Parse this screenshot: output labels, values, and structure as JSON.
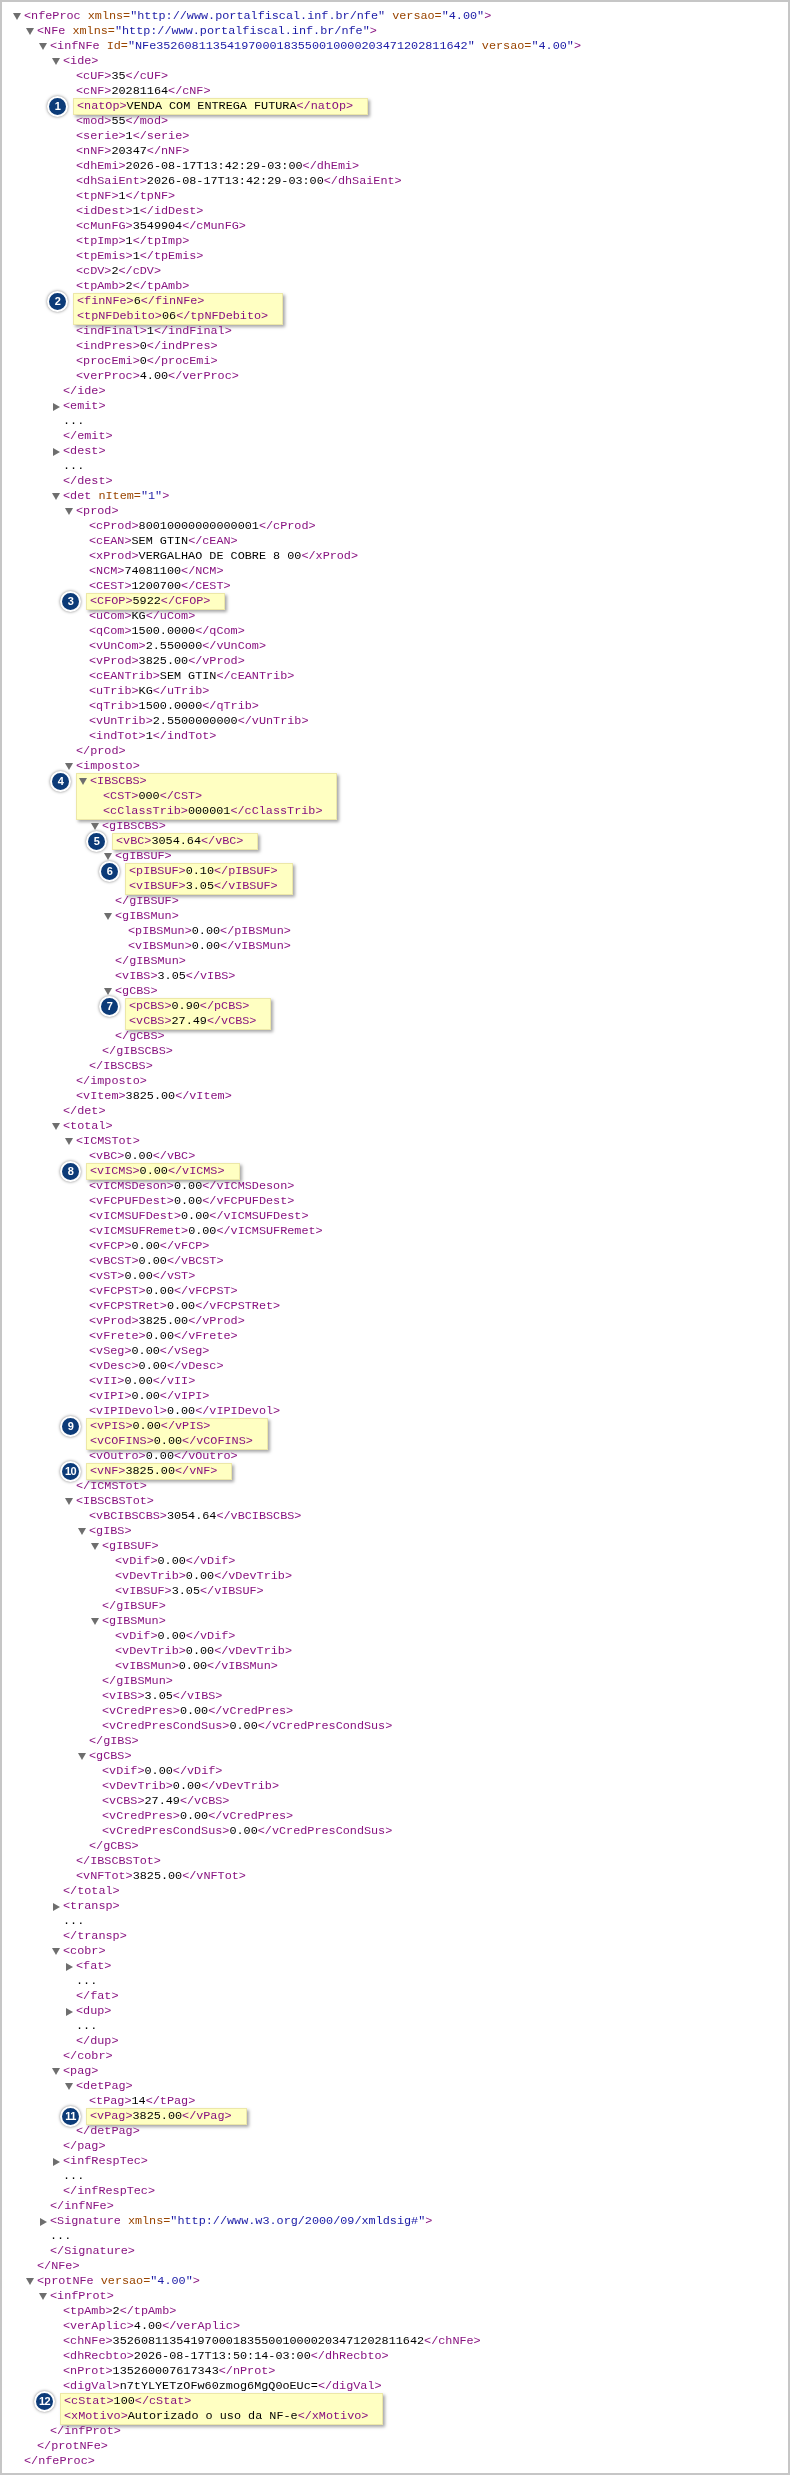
{
  "xml_tree": {
    "open_parts": [
      {
        "kind": "tag",
        "text": "<nfeProc"
      },
      {
        "kind": "attr",
        "text": " xmlns="
      },
      {
        "kind": "value",
        "text": "\"http://www.portalfiscal.inf.br/nfe\""
      },
      {
        "kind": "attr",
        "text": " versao="
      },
      {
        "kind": "value",
        "text": "\"4.00\""
      },
      {
        "kind": "tag",
        "text": ">"
      }
    ],
    "expanded": true,
    "close": "</nfeProc>",
    "children": [
      {
        "open_parts": [
          {
            "kind": "tag",
            "text": "<NFe"
          },
          {
            "kind": "attr",
            "text": " xmlns="
          },
          {
            "kind": "value",
            "text": "\"http://www.portalfiscal.inf.br/nfe\""
          },
          {
            "kind": "tag",
            "text": ">"
          }
        ],
        "expanded": true,
        "close": "</NFe>",
        "children": [
          {
            "open_parts": [
              {
                "kind": "tag",
                "text": "<infNFe"
              },
              {
                "kind": "attr",
                "text": " Id="
              },
              {
                "kind": "value",
                "text": "\"NFe35260811354197000183550010000203471202811642\""
              },
              {
                "kind": "attr",
                "text": " versao="
              },
              {
                "kind": "value",
                "text": "\"4.00\""
              },
              {
                "kind": "tag",
                "text": ">"
              }
            ],
            "expanded": true,
            "close": "</infNFe>",
            "children": [
              {
                "open": "<ide>",
                "expanded": true,
                "close": "</ide>",
                "children": [
                  {
                    "open": "<cUF>",
                    "value": "35",
                    "close": "</cUF>"
                  },
                  {
                    "open": "<cNF>",
                    "value": "20281164",
                    "close": "</cNF>"
                  },
                  {
                    "open": "<natOp>",
                    "value": "VENDA COM ENTREGA FUTURA",
                    "close": "</natOp>",
                    "highlight": true,
                    "badge": "1"
                  },
                  {
                    "open": "<mod>",
                    "value": "55",
                    "close": "</mod>"
                  },
                  {
                    "open": "<serie>",
                    "value": "1",
                    "close": "</serie>"
                  },
                  {
                    "open": "<nNF>",
                    "value": "20347",
                    "close": "</nNF>"
                  },
                  {
                    "open": "<dhEmi>",
                    "value": "2026-08-17T13:42:29-03:00",
                    "close": "</dhEmi>"
                  },
                  {
                    "open": "<dhSaiEnt>",
                    "value": "2026-08-17T13:42:29-03:00",
                    "close": "</dhSaiEnt>"
                  },
                  {
                    "open": "<tpNF>",
                    "value": "1",
                    "close": "</tpNF>"
                  },
                  {
                    "open": "<idDest>",
                    "value": "1",
                    "close": "</idDest>"
                  },
                  {
                    "open": "<cMunFG>",
                    "value": "3549904",
                    "close": "</cMunFG>"
                  },
                  {
                    "open": "<tpImp>",
                    "value": "1",
                    "close": "</tpImp>"
                  },
                  {
                    "open": "<tpEmis>",
                    "value": "1",
                    "close": "</tpEmis>"
                  },
                  {
                    "open": "<cDV>",
                    "value": "2",
                    "close": "</cDV>"
                  },
                  {
                    "open": "<tpAmb>",
                    "value": "2",
                    "close": "</tpAmb>"
                  },
                  {
                    "open": "<finNFe>",
                    "value": "6",
                    "close": "</finNFe>",
                    "highlight": true,
                    "badge": "2"
                  },
                  {
                    "open": "<tpNFDebito>",
                    "value": "06",
                    "close": "</tpNFDebito>",
                    "highlight": true
                  },
                  {
                    "open": "<indFinal>",
                    "value": "1",
                    "close": "</indFinal>"
                  },
                  {
                    "open": "<indPres>",
                    "value": "0",
                    "close": "</indPres>"
                  },
                  {
                    "open": "<procEmi>",
                    "value": "0",
                    "close": "</procEmi>"
                  },
                  {
                    "open": "<verProc>",
                    "value": "4.00",
                    "close": "</verProc>"
                  }
                ]
              },
              {
                "open": "<emit>",
                "expanded": false,
                "ellipsis": "...",
                "close": "</emit>"
              },
              {
                "open": "<dest>",
                "expanded": false,
                "ellipsis": "...",
                "close": "</dest>"
              },
              {
                "open_parts": [
                  {
                    "kind": "tag",
                    "text": "<det"
                  },
                  {
                    "kind": "attr",
                    "text": " nItem="
                  },
                  {
                    "kind": "value",
                    "text": "\"1\""
                  },
                  {
                    "kind": "tag",
                    "text": ">"
                  }
                ],
                "expanded": true,
                "close": "</det>",
                "children": [
                  {
                    "open": "<prod>",
                    "expanded": true,
                    "close": "</prod>",
                    "children": [
                      {
                        "open": "<cProd>",
                        "value": "80010000000000001",
                        "close": "</cProd>"
                      },
                      {
                        "open": "<cEAN>",
                        "value": "SEM GTIN",
                        "close": "</cEAN>"
                      },
                      {
                        "open": "<xProd>",
                        "value": "VERGALHAO DE COBRE 8 00",
                        "close": "</xProd>"
                      },
                      {
                        "open": "<NCM>",
                        "value": "74081100",
                        "close": "</NCM>"
                      },
                      {
                        "open": "<CEST>",
                        "value": "1200700",
                        "close": "</CEST>"
                      },
                      {
                        "open": "<CFOP>",
                        "value": "5922",
                        "close": "</CFOP>",
                        "highlight": true,
                        "badge": "3"
                      },
                      {
                        "open": "<uCom>",
                        "value": "KG",
                        "close": "</uCom>"
                      },
                      {
                        "open": "<qCom>",
                        "value": "1500.0000",
                        "close": "</qCom>"
                      },
                      {
                        "open": "<vUnCom>",
                        "value": "2.550000",
                        "close": "</vUnCom>"
                      },
                      {
                        "open": "<vProd>",
                        "value": "3825.00",
                        "close": "</vProd>"
                      },
                      {
                        "open": "<cEANTrib>",
                        "value": "SEM GTIN",
                        "close": "</cEANTrib>"
                      },
                      {
                        "open": "<uTrib>",
                        "value": "KG",
                        "close": "</uTrib>"
                      },
                      {
                        "open": "<qTrib>",
                        "value": "1500.0000",
                        "close": "</qTrib>"
                      },
                      {
                        "open": "<vUnTrib>",
                        "value": "2.5500000000",
                        "close": "</vUnTrib>"
                      },
                      {
                        "open": "<indTot>",
                        "value": "1",
                        "close": "</indTot>"
                      }
                    ]
                  },
                  {
                    "open": "<imposto>",
                    "expanded": true,
                    "close": "</imposto>",
                    "children": [
                      {
                        "open": "<IBSCBS>",
                        "expanded": true,
                        "close": "</IBSCBS>",
                        "highlight": true,
                        "badge": "4",
                        "children": [
                          {
                            "open": "<CST>",
                            "value": "000",
                            "close": "</CST>",
                            "highlight": true
                          },
                          {
                            "open": "<cClassTrib>",
                            "value": "000001",
                            "close": "</cClassTrib>",
                            "highlight": true
                          },
                          {
                            "open": "<gIBSCBS>",
                            "expanded": true,
                            "close": "</gIBSCBS>",
                            "children": [
                              {
                                "open": "<vBC>",
                                "value": "3054.64",
                                "close": "</vBC>",
                                "highlight": true,
                                "badge": "5"
                              },
                              {
                                "open": "<gIBSUF>",
                                "expanded": true,
                                "close": "</gIBSUF>",
                                "children": [
                                  {
                                    "open": "<pIBSUF>",
                                    "value": "0.10",
                                    "close": "</pIBSUF>",
                                    "highlight": true,
                                    "badge": "6"
                                  },
                                  {
                                    "open": "<vIBSUF>",
                                    "value": "3.05",
                                    "close": "</vIBSUF>",
                                    "highlight": true
                                  }
                                ]
                              },
                              {
                                "open": "<gIBSMun>",
                                "expanded": true,
                                "close": "</gIBSMun>",
                                "children": [
                                  {
                                    "open": "<pIBSMun>",
                                    "value": "0.00",
                                    "close": "</pIBSMun>"
                                  },
                                  {
                                    "open": "<vIBSMun>",
                                    "value": "0.00",
                                    "close": "</vIBSMun>"
                                  }
                                ]
                              },
                              {
                                "open": "<vIBS>",
                                "value": "3.05",
                                "close": "</vIBS>"
                              },
                              {
                                "open": "<gCBS>",
                                "expanded": true,
                                "close": "</gCBS>",
                                "children": [
                                  {
                                    "open": "<pCBS>",
                                    "value": "0.90",
                                    "close": "</pCBS>",
                                    "highlight": true,
                                    "badge": "7"
                                  },
                                  {
                                    "open": "<vCBS>",
                                    "value": "27.49",
                                    "close": "</vCBS>",
                                    "highlight": true
                                  }
                                ]
                              }
                            ]
                          }
                        ]
                      }
                    ]
                  },
                  {
                    "open": "<vItem>",
                    "value": "3825.00",
                    "close": "</vItem>"
                  }
                ]
              },
              {
                "open": "<total>",
                "expanded": true,
                "close": "</total>",
                "children": [
                  {
                    "open": "<ICMSTot>",
                    "expanded": true,
                    "close": "</ICMSTot>",
                    "children": [
                      {
                        "open": "<vBC>",
                        "value": "0.00",
                        "close": "</vBC>"
                      },
                      {
                        "open": "<vICMS>",
                        "value": "0.00",
                        "close": "</vICMS>",
                        "highlight": true,
                        "badge": "8"
                      },
                      {
                        "open": "<vICMSDeson>",
                        "value": "0.00",
                        "close": "</vICMSDeson>"
                      },
                      {
                        "open": "<vFCPUFDest>",
                        "value": "0.00",
                        "close": "</vFCPUFDest>"
                      },
                      {
                        "open": "<vICMSUFDest>",
                        "value": "0.00",
                        "close": "</vICMSUFDest>"
                      },
                      {
                        "open": "<vICMSUFRemet>",
                        "value": "0.00",
                        "close": "</vICMSUFRemet>"
                      },
                      {
                        "open": "<vFCP>",
                        "value": "0.00",
                        "close": "</vFCP>"
                      },
                      {
                        "open": "<vBCST>",
                        "value": "0.00",
                        "close": "</vBCST>"
                      },
                      {
                        "open": "<vST>",
                        "value": "0.00",
                        "close": "</vST>"
                      },
                      {
                        "open": "<vFCPST>",
                        "value": "0.00",
                        "close": "</vFCPST>"
                      },
                      {
                        "open": "<vFCPSTRet>",
                        "value": "0.00",
                        "close": "</vFCPSTRet>"
                      },
                      {
                        "open": "<vProd>",
                        "value": "3825.00",
                        "close": "</vProd>"
                      },
                      {
                        "open": "<vFrete>",
                        "value": "0.00",
                        "close": "</vFrete>"
                      },
                      {
                        "open": "<vSeg>",
                        "value": "0.00",
                        "close": "</vSeg>"
                      },
                      {
                        "open": "<vDesc>",
                        "value": "0.00",
                        "close": "</vDesc>"
                      },
                      {
                        "open": "<vII>",
                        "value": "0.00",
                        "close": "</vII>"
                      },
                      {
                        "open": "<vIPI>",
                        "value": "0.00",
                        "close": "</vIPI>"
                      },
                      {
                        "open": "<vIPIDevol>",
                        "value": "0.00",
                        "close": "</vIPIDevol>"
                      },
                      {
                        "open": "<vPIS>",
                        "value": "0.00",
                        "close": "</vPIS>",
                        "highlight": true,
                        "badge": "9"
                      },
                      {
                        "open": "<vCOFINS>",
                        "value": "0.00",
                        "close": "</vCOFINS>",
                        "highlight": true
                      },
                      {
                        "open": "<vOutro>",
                        "value": "0.00",
                        "close": "</vOutro>"
                      },
                      {
                        "open": "<vNF>",
                        "value": "3825.00",
                        "close": "</vNF>",
                        "highlight": true,
                        "badge": "10"
                      }
                    ]
                  },
                  {
                    "open": "<IBSCBSTot>",
                    "expanded": true,
                    "close": "</IBSCBSTot>",
                    "children": [
                      {
                        "open": "<vBCIBSCBS>",
                        "value": "3054.64",
                        "close": "</vBCIBSCBS>"
                      },
                      {
                        "open": "<gIBS>",
                        "expanded": true,
                        "close": "</gIBS>",
                        "children": [
                          {
                            "open": "<gIBSUF>",
                            "expanded": true,
                            "close": "</gIBSUF>",
                            "children": [
                              {
                                "open": "<vDif>",
                                "value": "0.00",
                                "close": "</vDif>"
                              },
                              {
                                "open": "<vDevTrib>",
                                "value": "0.00",
                                "close": "</vDevTrib>"
                              },
                              {
                                "open": "<vIBSUF>",
                                "value": "3.05",
                                "close": "</vIBSUF>"
                              }
                            ]
                          },
                          {
                            "open": "<gIBSMun>",
                            "expanded": true,
                            "close": "</gIBSMun>",
                            "children": [
                              {
                                "open": "<vDif>",
                                "value": "0.00",
                                "close": "</vDif>"
                              },
                              {
                                "open": "<vDevTrib>",
                                "value": "0.00",
                                "close": "</vDevTrib>"
                              },
                              {
                                "open": "<vIBSMun>",
                                "value": "0.00",
                                "close": "</vIBSMun>"
                              }
                            ]
                          },
                          {
                            "open": "<vIBS>",
                            "value": "3.05",
                            "close": "</vIBS>"
                          },
                          {
                            "open": "<vCredPres>",
                            "value": "0.00",
                            "close": "</vCredPres>"
                          },
                          {
                            "open": "<vCredPresCondSus>",
                            "value": "0.00",
                            "close": "</vCredPresCondSus>"
                          }
                        ]
                      },
                      {
                        "open": "<gCBS>",
                        "expanded": true,
                        "close": "</gCBS>",
                        "children": [
                          {
                            "open": "<vDif>",
                            "value": "0.00",
                            "close": "</vDif>"
                          },
                          {
                            "open": "<vDevTrib>",
                            "value": "0.00",
                            "close": "</vDevTrib>"
                          },
                          {
                            "open": "<vCBS>",
                            "value": "27.49",
                            "close": "</vCBS>"
                          },
                          {
                            "open": "<vCredPres>",
                            "value": "0.00",
                            "close": "</vCredPres>"
                          },
                          {
                            "open": "<vCredPresCondSus>",
                            "value": "0.00",
                            "close": "</vCredPresCondSus>"
                          }
                        ]
                      }
                    ]
                  },
                  {
                    "open": "<vNFTot>",
                    "value": "3825.00",
                    "close": "</vNFTot>"
                  }
                ]
              },
              {
                "open": "<transp>",
                "expanded": false,
                "ellipsis": "...",
                "close": "</transp>"
              },
              {
                "open": "<cobr>",
                "expanded": true,
                "close": "</cobr>",
                "children": [
                  {
                    "open": "<fat>",
                    "expanded": false,
                    "ellipsis": "...",
                    "close": "</fat>"
                  },
                  {
                    "open": "<dup>",
                    "expanded": false,
                    "ellipsis": "...",
                    "close": "</dup>"
                  }
                ]
              },
              {
                "open": "<pag>",
                "expanded": true,
                "close": "</pag>",
                "children": [
                  {
                    "open": "<detPag>",
                    "expanded": true,
                    "close": "</detPag>",
                    "children": [
                      {
                        "open": "<tPag>",
                        "value": "14",
                        "close": "</tPag>"
                      },
                      {
                        "open": "<vPag>",
                        "value": "3825.00",
                        "close": "</vPag>",
                        "highlight": true,
                        "badge": "11"
                      }
                    ]
                  }
                ]
              },
              {
                "open": "<infRespTec>",
                "expanded": false,
                "ellipsis": "...",
                "close": "</infRespTec>"
              }
            ]
          },
          {
            "open_parts": [
              {
                "kind": "tag",
                "text": "<Signature"
              },
              {
                "kind": "attr",
                "text": " xmlns="
              },
              {
                "kind": "value",
                "text": "\"http://www.w3.org/2000/09/xmldsig#\""
              },
              {
                "kind": "tag",
                "text": ">"
              }
            ],
            "expanded": false,
            "ellipsis": "...",
            "close": "</Signature>"
          }
        ]
      },
      {
        "open_parts": [
          {
            "kind": "tag",
            "text": "<protNFe"
          },
          {
            "kind": "attr",
            "text": " versao="
          },
          {
            "kind": "value",
            "text": "\"4.00\""
          },
          {
            "kind": "tag",
            "text": ">"
          }
        ],
        "expanded": true,
        "close": "</protNFe>",
        "children": [
          {
            "open": "<infProt>",
            "expanded": true,
            "close": "</infProt>",
            "children": [
              {
                "open": "<tpAmb>",
                "value": "2",
                "close": "</tpAmb>"
              },
              {
                "open": "<verAplic>",
                "value": "4.00",
                "close": "</verAplic>"
              },
              {
                "open": "<chNFe>",
                "value": "35260811354197000183550010000203471202811642",
                "close": "</chNFe>"
              },
              {
                "open": "<dhRecbto>",
                "value": "2026-08-17T13:50:14-03:00",
                "close": "</dhRecbto>"
              },
              {
                "open": "<nProt>",
                "value": "135260007617343",
                "close": "</nProt>"
              },
              {
                "open": "<digVal>",
                "value": "n7tYLYETzOFw60zmog6MgQ0oEUc=",
                "close": "</digVal>"
              },
              {
                "open": "<cStat>",
                "value": "100",
                "close": "</cStat>",
                "highlight": true,
                "badge": "12"
              },
              {
                "open": "<xMotivo>",
                "value": "Autorizado o uso da NF-e",
                "close": "</xMotivo>",
                "highlight": true
              }
            ]
          }
        ]
      }
    ]
  }
}
